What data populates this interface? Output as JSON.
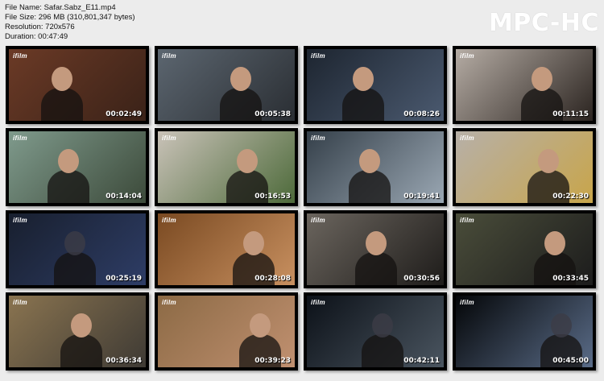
{
  "file_info": {
    "name_line": "File Name: Safar.Sabz_E11.mp4",
    "size_line": "File Size: 296 MB (310,801,347 bytes)",
    "resolution_line": "Resolution: 720x576",
    "duration_line": "Duration: 00:47:49"
  },
  "logo": "MPC-HC",
  "thumbnails": [
    {
      "timestamp": "00:02:49",
      "channel": "ifilm",
      "bg": "#6b3a26",
      "accent": "#3a2218"
    },
    {
      "timestamp": "00:05:38",
      "channel": "ifilm",
      "bg": "#5c6670",
      "accent": "#2a2e33"
    },
    {
      "timestamp": "00:08:26",
      "channel": "ifilm",
      "bg": "#1d2530",
      "accent": "#4b5a70"
    },
    {
      "timestamp": "00:11:15",
      "channel": "ifilm",
      "bg": "#b5aca4",
      "accent": "#2b2420"
    },
    {
      "timestamp": "00:14:04",
      "channel": "ifilm",
      "bg": "#7f9a8c",
      "accent": "#3c4a3a"
    },
    {
      "timestamp": "00:16:53",
      "channel": "ifilm",
      "bg": "#c9c2b8",
      "accent": "#4d6a3a"
    },
    {
      "timestamp": "00:19:41",
      "channel": "ifilm",
      "bg": "#35404a",
      "accent": "#9aa7b3"
    },
    {
      "timestamp": "00:22:30",
      "channel": "ifilm",
      "bg": "#b7b0a8",
      "accent": "#c8a54a"
    },
    {
      "timestamp": "00:25:19",
      "channel": "ifilm",
      "bg": "#181f2e",
      "accent": "#2e3d66"
    },
    {
      "timestamp": "00:28:08",
      "channel": "ifilm",
      "bg": "#7a4a22",
      "accent": "#c89060"
    },
    {
      "timestamp": "00:30:56",
      "channel": "ifilm",
      "bg": "#6b655e",
      "accent": "#1e1c1a"
    },
    {
      "timestamp": "00:33:45",
      "channel": "ifilm",
      "bg": "#4a4d3a",
      "accent": "#1c1c1c"
    },
    {
      "timestamp": "00:36:34",
      "channel": "ifilm",
      "bg": "#8a7450",
      "accent": "#3e3a34"
    },
    {
      "timestamp": "00:39:23",
      "channel": "ifilm",
      "bg": "#8c6a45",
      "accent": "#c09070"
    },
    {
      "timestamp": "00:42:11",
      "channel": "ifilm",
      "bg": "#0c1118",
      "accent": "#4a5560"
    },
    {
      "timestamp": "00:45:00",
      "channel": "ifilm",
      "bg": "#040608",
      "accent": "#5a6c88"
    }
  ]
}
